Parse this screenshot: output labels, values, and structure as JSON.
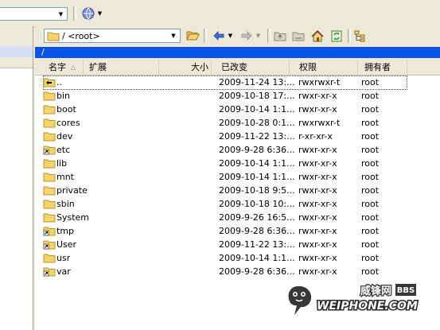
{
  "path": {
    "root_label": "/ <root>",
    "current": "/"
  },
  "columns": {
    "name": "名字",
    "ext": "扩展",
    "size": "大小",
    "modified": "已改变",
    "perms": "权限",
    "owner": "拥有者"
  },
  "files": [
    {
      "name": "..",
      "modified": "2009-11-24 13:...",
      "perms": "rwxrwxr-t",
      "owner": "root",
      "icon": "parent-folder-icon"
    },
    {
      "name": "bin",
      "modified": "2009-10-18 17:...",
      "perms": "rwxr-xr-x",
      "owner": "root",
      "icon": "folder-icon"
    },
    {
      "name": "boot",
      "modified": "2009-10-14 1:1...",
      "perms": "rwxr-xr-x",
      "owner": "root",
      "icon": "folder-icon"
    },
    {
      "name": "cores",
      "modified": "2009-10-28 0:1...",
      "perms": "rwxrwxr-t",
      "owner": "root",
      "icon": "folder-icon"
    },
    {
      "name": "dev",
      "modified": "2009-11-22 13:...",
      "perms": "r-xr-xr-x",
      "owner": "root",
      "icon": "folder-icon"
    },
    {
      "name": "etc",
      "modified": "2009-9-28 6:36...",
      "perms": "rwxr-xr-x",
      "owner": "root",
      "icon": "folder-link-icon"
    },
    {
      "name": "lib",
      "modified": "2009-10-14 1:1...",
      "perms": "rwxr-xr-x",
      "owner": "root",
      "icon": "folder-icon"
    },
    {
      "name": "mnt",
      "modified": "2009-10-14 1:1...",
      "perms": "rwxr-xr-x",
      "owner": "root",
      "icon": "folder-icon"
    },
    {
      "name": "private",
      "modified": "2009-10-18 9:5...",
      "perms": "rwxr-xr-x",
      "owner": "root",
      "icon": "folder-icon"
    },
    {
      "name": "sbin",
      "modified": "2009-10-18 10:...",
      "perms": "rwxr-xr-x",
      "owner": "root",
      "icon": "folder-icon"
    },
    {
      "name": "System",
      "modified": "2009-9-26 16:5...",
      "perms": "rwxr-xr-x",
      "owner": "root",
      "icon": "folder-icon"
    },
    {
      "name": "tmp",
      "modified": "2009-9-28 6:36...",
      "perms": "rwxr-xr-x",
      "owner": "root",
      "icon": "folder-link-icon"
    },
    {
      "name": "User",
      "modified": "2009-11-22 13:...",
      "perms": "rwxr-xr-x",
      "owner": "root",
      "icon": "folder-link-icon"
    },
    {
      "name": "usr",
      "modified": "2009-10-14 1:1...",
      "perms": "rwxr-xr-x",
      "owner": "root",
      "icon": "folder-icon"
    },
    {
      "name": "var",
      "modified": "2009-9-28 6:36...",
      "perms": "rwxr-xr-x",
      "owner": "root",
      "icon": "folder-link-icon"
    }
  ],
  "watermark": {
    "brand": "威锋网",
    "site": "WEIPHONE.COM",
    "tag": "BBS"
  },
  "colors": {
    "path_bar": "#0a55e8",
    "folder": "#f5d36b",
    "folder_edge": "#b8962e",
    "selection": "#b9cdf0"
  }
}
